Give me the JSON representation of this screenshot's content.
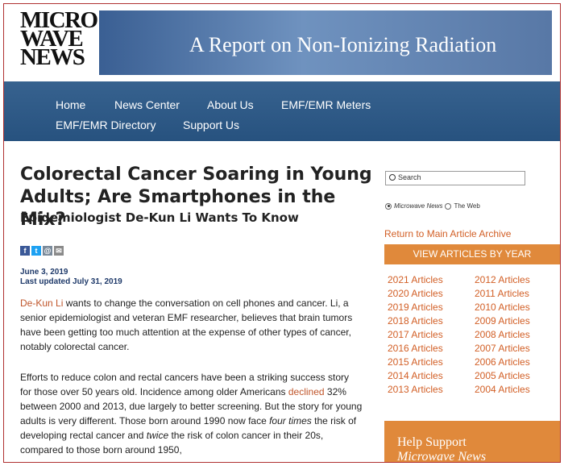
{
  "logo": {
    "line1": "MICRO",
    "line2": "WAVE",
    "line3": "NEWS"
  },
  "banner": {
    "title": "A Report on Non-Ionizing Radiation"
  },
  "nav": {
    "items": [
      "Home",
      "News Center",
      "About Us",
      "EMF/EMR Meters",
      "EMF/EMR Directory",
      "Support Us"
    ]
  },
  "article": {
    "title": "Colorectal Cancer Soaring in Young Adults; Are Smartphones in the Mix?",
    "subtitle": "Epidemiologist De-Kun Li Wants To Know",
    "date": "June 3, 2019",
    "updated": "Last updated July 31, 2019",
    "p1": {
      "link": "De-Kun Li",
      "text": " wants to change the conversation on cell phones and cancer. Li, a senior epidemiologist and veteran EMF researcher, believes that brain tumors have been getting too much attention at the expense of other types of cancer, notably colorectal cancer."
    },
    "p2": {
      "a": "Efforts to reduce colon and rectal cancers have been a striking success story for those over 50 years old. Incidence among older Americans ",
      "link": "declined",
      "b": " 32% between 2000 and 2013, due largely to better screening. But the story for young adults is very different. Those born around 1990 now face ",
      "em1": "four times",
      "c": " the risk of developing rectal cancer and ",
      "em2": "twice",
      "d": " the risk of colon cancer in their 20s, compared to those born around 1950,"
    }
  },
  "share": {
    "facebook": "f",
    "twitter": "t",
    "email": "@",
    "print": "✉",
    "colors": {
      "facebook": "#3b5998",
      "twitter": "#1da1f2",
      "email": "#7a8a9a",
      "print": "#8a8a8a"
    }
  },
  "sidebar": {
    "search_label": "Search",
    "radio_site": "Microwave News",
    "radio_web": "The Web",
    "archive_link": "Return to Main Article Archive",
    "years_header": "VIEW ARTICLES BY YEAR",
    "years_left": [
      "2021 Articles",
      "2020 Articles",
      "2019 Articles",
      "2018 Articles",
      "2017 Articles",
      "2016 Articles",
      "2015 Articles",
      "2014 Articles",
      "2013 Articles"
    ],
    "years_right": [
      "2012 Articles",
      "2011 Articles",
      "2010 Articles",
      "2009 Articles",
      "2008 Articles",
      "2007 Articles",
      "2006 Articles",
      "2005 Articles",
      "2004 Articles"
    ],
    "help_line1": "Help Support",
    "help_line2": "Microwave News"
  },
  "colors": {
    "accent_orange": "#e0893b",
    "link_orange": "#d25f26",
    "nav_blue": "#2f5a87"
  }
}
